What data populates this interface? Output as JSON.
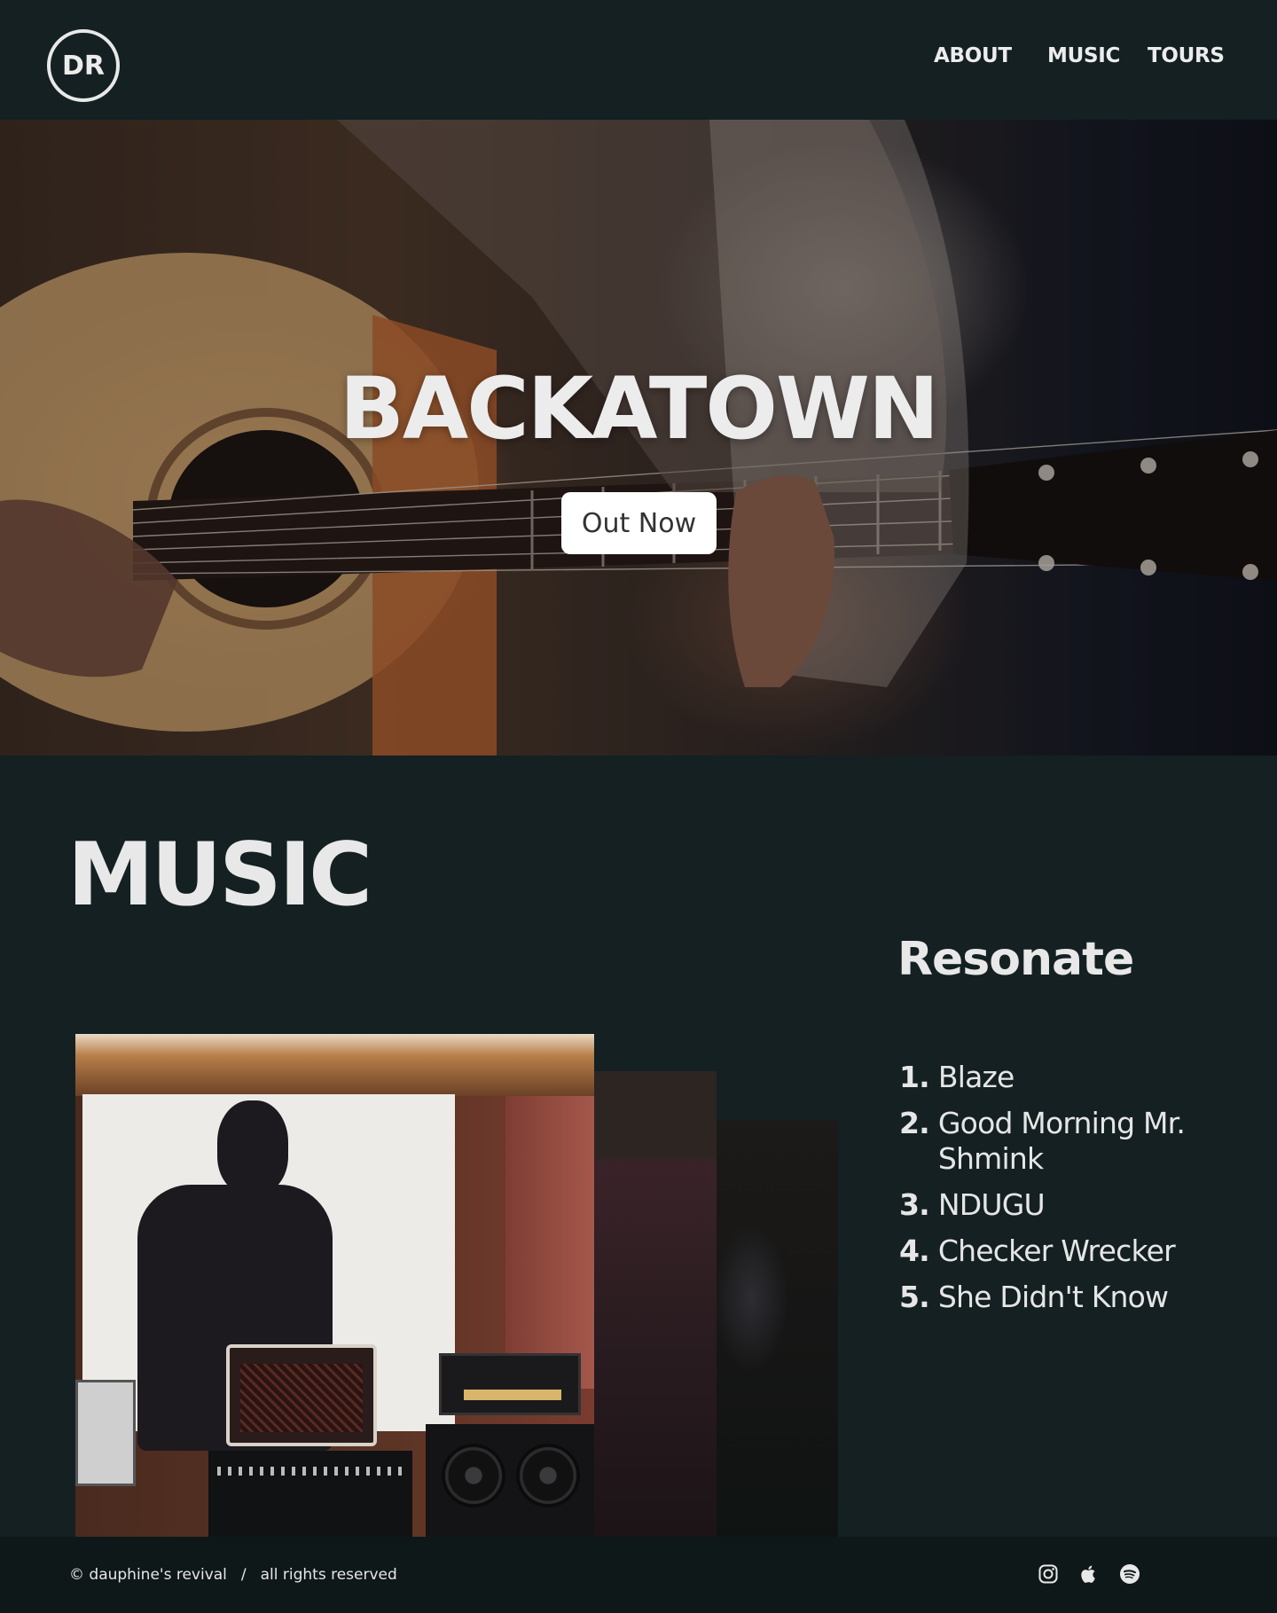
{
  "header": {
    "logo_text": "DR",
    "nav": {
      "about": "ABOUT",
      "music": "MUSIC",
      "tours": "TOURS"
    }
  },
  "hero": {
    "title": "BACKATOWN",
    "button_label": "Out Now"
  },
  "music": {
    "section_title": "MUSIC",
    "album": {
      "title": "Resonate",
      "tracks": [
        {
          "number": "1.",
          "name": "Blaze"
        },
        {
          "number": "2.",
          "name": "Good Morning Mr. Shmink"
        },
        {
          "number": "3.",
          "name": "NDUGU"
        },
        {
          "number": "4.",
          "name": "Checker Wrecker"
        },
        {
          "number": "5.",
          "name": "She Didn't Know"
        }
      ]
    }
  },
  "footer": {
    "copyright": "© dauphine's revival",
    "separator": "/",
    "rights": "all rights reserved",
    "social_icons": [
      "instagram-icon",
      "apple-icon",
      "spotify-icon"
    ]
  },
  "colors": {
    "background": "#142022",
    "footer_background": "#0f1819",
    "text": "#e8e8e8",
    "button_background": "#ffffff",
    "button_text": "#333333"
  }
}
